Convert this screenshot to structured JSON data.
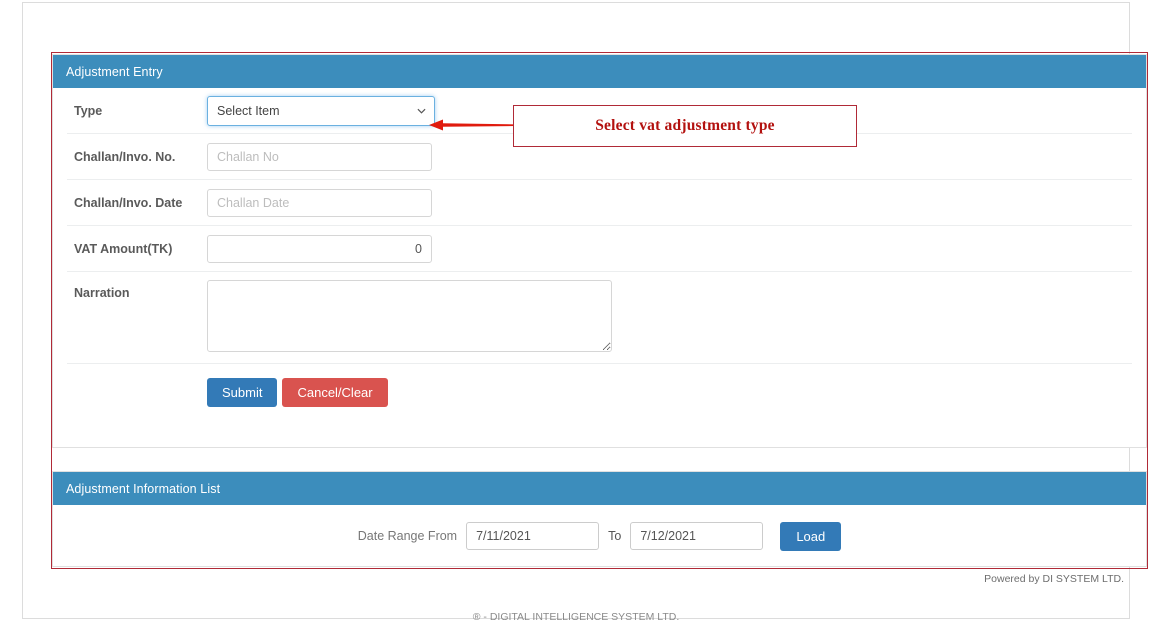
{
  "entry_panel": {
    "title": "Adjustment Entry",
    "fields": {
      "type_label": "Type",
      "type_value": "Select Item",
      "challan_no_label": "Challan/Invo. No.",
      "challan_no_placeholder": "Challan No",
      "challan_no_value": "",
      "challan_date_label": "Challan/Invo. Date",
      "challan_date_placeholder": "Challan Date",
      "challan_date_value": "",
      "vat_amount_label": "VAT Amount(TK)",
      "vat_amount_value": "0",
      "narration_label": "Narration",
      "narration_value": ""
    },
    "buttons": {
      "submit": "Submit",
      "cancel": "Cancel/Clear"
    }
  },
  "annotation": {
    "text": "Select vat adjustment type",
    "color": "#b3110f",
    "border_color": "#b02a37"
  },
  "list_panel": {
    "title": "Adjustment Information List",
    "date_range_from_label": "Date Range From",
    "date_from": "7/11/2021",
    "to_label": "To",
    "date_to": "7/12/2021",
    "load_label": "Load"
  },
  "footer": {
    "powered_by": "Powered by DI SYSTEM LTD.",
    "copyright": "®  - DIGITAL INTELLIGENCE SYSTEM LTD."
  },
  "theme": {
    "panel_header_blue": "#3c8dbc",
    "primary_blue": "#337ab7",
    "danger_red": "#d9534f",
    "outline_red": "#b02a37"
  },
  "icons": {
    "chevron_down": "chevron-down-icon",
    "arrow_left": "arrow-left-icon",
    "resize_grip": "resize-grip-icon"
  }
}
